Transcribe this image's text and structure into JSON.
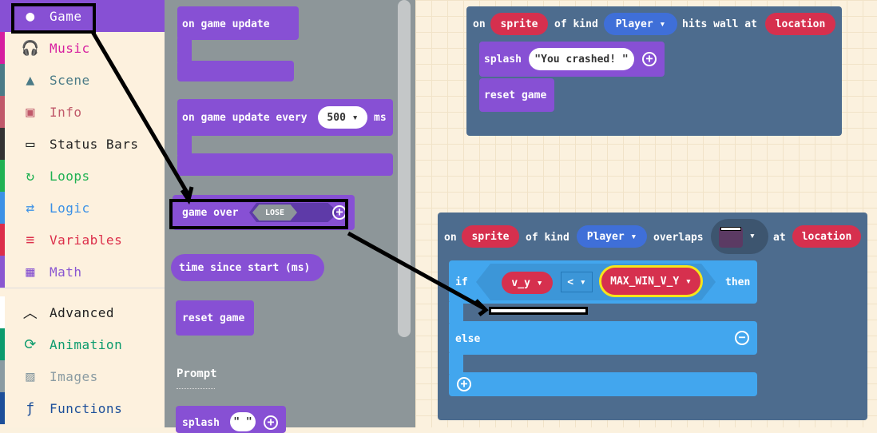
{
  "toolbox": {
    "categories": [
      {
        "label": "Game",
        "color": "#ffffff",
        "bg": "#8750d4",
        "icon": "circle-icon"
      },
      {
        "label": "Music",
        "color": "#d61ea0",
        "icon": "headphones-icon"
      },
      {
        "label": "Scene",
        "color": "#4b7b87",
        "icon": "tree-icon"
      },
      {
        "label": "Info",
        "color": "#c0596a",
        "icon": "id-card-icon"
      },
      {
        "label": "Status Bars",
        "color": "#222222",
        "icon": "battery-icon"
      },
      {
        "label": "Loops",
        "color": "#20b152",
        "icon": "refresh-icon"
      },
      {
        "label": "Logic",
        "color": "#3c91e6",
        "icon": "shuffle-icon"
      },
      {
        "label": "Variables",
        "color": "#dc2e4a",
        "icon": "lines-icon"
      },
      {
        "label": "Math",
        "color": "#8a57d1",
        "icon": "grid-icon"
      },
      {
        "label": "Advanced",
        "color": "#222222",
        "icon": "chevron-up-icon"
      },
      {
        "label": "Animation",
        "color": "#0b9b6d",
        "icon": "loop-icon"
      },
      {
        "label": "Images",
        "color": "#8a9ba2",
        "icon": "image-icon"
      },
      {
        "label": "Functions",
        "color": "#1d4f9a",
        "icon": "function-icon"
      }
    ]
  },
  "flyout": {
    "on_game_update": "on game update",
    "on_game_update_every": "on game update every",
    "interval_value": "500",
    "interval_unit": "ms",
    "game_over": "game over",
    "lose": "LOSE",
    "time_since_start": "time since start (ms)",
    "reset_game": "reset game",
    "prompt_header": "Prompt",
    "splash": "splash",
    "splash_empty": "\" \""
  },
  "workspace": {
    "block1": {
      "on": "on",
      "sprite": "sprite",
      "of_kind": "of kind",
      "kind": "Player",
      "hits_wall_at": "hits wall at",
      "location": "location",
      "splash": "splash",
      "splash_text": "\"You crashed! \"",
      "reset_game": "reset game"
    },
    "block2": {
      "on": "on",
      "sprite": "sprite",
      "of_kind": "of kind",
      "kind": "Player",
      "overlaps": "overlaps",
      "at": "at",
      "location": "location",
      "if": "if",
      "var": "v_y",
      "op": "<",
      "max": "MAX_WIN_V_Y",
      "then": "then",
      "else": "else"
    }
  },
  "colors": {
    "game": "#8750d4",
    "variables": "#d6304e",
    "sprites": "#4d6c8e",
    "logic": "#42a6ee",
    "kind": "#3f6fd8"
  }
}
